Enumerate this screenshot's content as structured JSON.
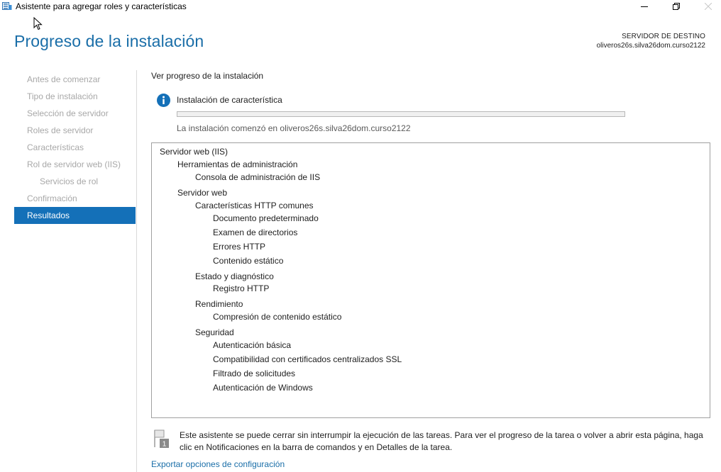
{
  "window": {
    "title": "Asistente para agregar roles y características"
  },
  "header": {
    "page_title": "Progreso de la instalación",
    "destination_label": "SERVIDOR DE DESTINO",
    "destination_server": "oliveros26s.silva26dom.curso2122"
  },
  "nav": {
    "items": [
      {
        "label": "Antes de comenzar",
        "state": "disabled"
      },
      {
        "label": "Tipo de instalación",
        "state": "disabled"
      },
      {
        "label": "Selección de servidor",
        "state": "disabled"
      },
      {
        "label": "Roles de servidor",
        "state": "disabled"
      },
      {
        "label": "Características",
        "state": "disabled"
      },
      {
        "label": "Rol de servidor web (IIS)",
        "state": "disabled"
      },
      {
        "label": "Servicios de rol",
        "state": "disabled"
      },
      {
        "label": "Confirmación",
        "state": "disabled"
      },
      {
        "label": "Resultados",
        "state": "active"
      }
    ]
  },
  "main": {
    "section_label": "Ver progreso de la instalación",
    "status_text": "Instalación de característica",
    "progress_fraction": 0,
    "start_text": "La instalación comenzó en oliveros26s.silva26dom.curso2122",
    "features": [
      {
        "label": "Servidor web (IIS)",
        "level": 0
      },
      {
        "label": "Herramientas de administración",
        "level": 1
      },
      {
        "label": "Consola de administración de IIS",
        "level": 2
      },
      {
        "label": "Servidor web",
        "level": 1
      },
      {
        "label": "Características HTTP comunes",
        "level": 2
      },
      {
        "label": "Documento predeterminado",
        "level": 3
      },
      {
        "label": "Examen de directorios",
        "level": 3
      },
      {
        "label": "Errores HTTP",
        "level": 3
      },
      {
        "label": "Contenido estático",
        "level": 3
      },
      {
        "label": "Estado y diagnóstico",
        "level": 2
      },
      {
        "label": "Registro HTTP",
        "level": 3
      },
      {
        "label": "Rendimiento",
        "level": 2
      },
      {
        "label": "Compresión de contenido estático",
        "level": 3
      },
      {
        "label": "Seguridad",
        "level": 2
      },
      {
        "label": "Autenticación básica",
        "level": 3
      },
      {
        "label": "Compatibilidad con certificados centralizados SSL",
        "level": 3
      },
      {
        "label": "Filtrado de solicitudes",
        "level": 3
      },
      {
        "label": "Autenticación de Windows",
        "level": 3
      }
    ],
    "footer_note": "Este asistente se puede cerrar sin interrumpir la ejecución de las tareas. Para ver el progreso de la tarea o volver a abrir esta página, haga clic en Notificaciones en la barra de comandos y en Detalles de la tarea.",
    "flag_badge": "1",
    "export_link": "Exportar opciones de configuración"
  },
  "colors": {
    "accent": "#1470b8",
    "title_blue": "#1a6ea8",
    "disabled_text": "#a8a8a8"
  },
  "icons": [
    "app-icon",
    "minimize-icon",
    "restore-icon",
    "close-icon",
    "info-icon",
    "flag-notification-icon",
    "mouse-cursor-icon"
  ]
}
